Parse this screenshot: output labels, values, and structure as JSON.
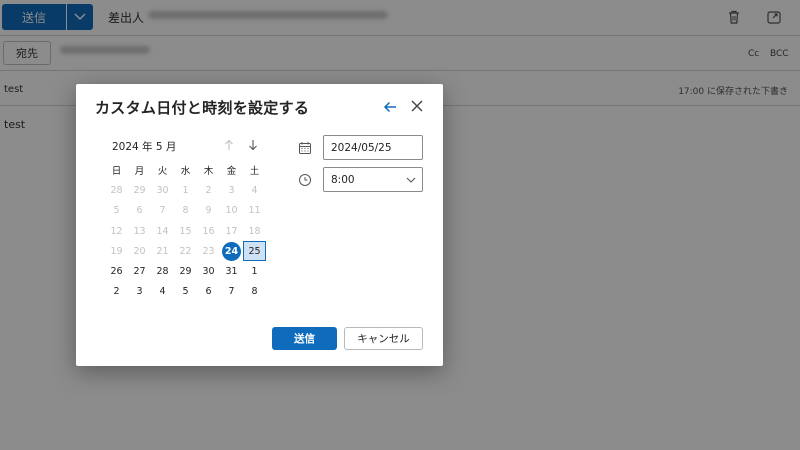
{
  "toolbar": {
    "send_label": "送信",
    "from_label": "差出人"
  },
  "to_row": {
    "to_label": "宛先",
    "cc_label": "Cc",
    "bcc_label": "BCC"
  },
  "subject_row": {
    "subject": "test",
    "saved_status": "17:00 に保存された下書き"
  },
  "body": {
    "text": "test"
  },
  "dialog": {
    "title": "カスタム日付と時刻を設定する",
    "month_label": "2024 年 5 月",
    "weekdays": [
      "日",
      "月",
      "火",
      "水",
      "木",
      "金",
      "土"
    ],
    "weeks": [
      [
        "28",
        "29",
        "30",
        "1",
        "2",
        "3",
        "4"
      ],
      [
        "5",
        "6",
        "7",
        "8",
        "9",
        "10",
        "11"
      ],
      [
        "12",
        "13",
        "14",
        "15",
        "16",
        "17",
        "18"
      ],
      [
        "19",
        "20",
        "21",
        "22",
        "23",
        "24",
        "25"
      ],
      [
        "26",
        "27",
        "28",
        "29",
        "30",
        "31",
        "1"
      ],
      [
        "2",
        "3",
        "4",
        "5",
        "6",
        "7",
        "8"
      ]
    ],
    "today": "24",
    "selected": "25",
    "date_value": "2024/05/25",
    "time_value": "8:00",
    "send_button": "送信",
    "cancel_button": "キャンセル"
  },
  "colors": {
    "accent": "#0f6cbd",
    "selected_fill": "#cfe1f5",
    "disabled_text": "#c2c2c2"
  },
  "icons": {
    "toolbar": [
      "chevron-down-icon",
      "trash-icon",
      "popout-icon"
    ],
    "dialog": [
      "back-arrow-icon",
      "close-icon",
      "arrow-up-icon",
      "arrow-down-icon",
      "calendar-icon",
      "clock-icon",
      "chevron-down-icon"
    ]
  }
}
